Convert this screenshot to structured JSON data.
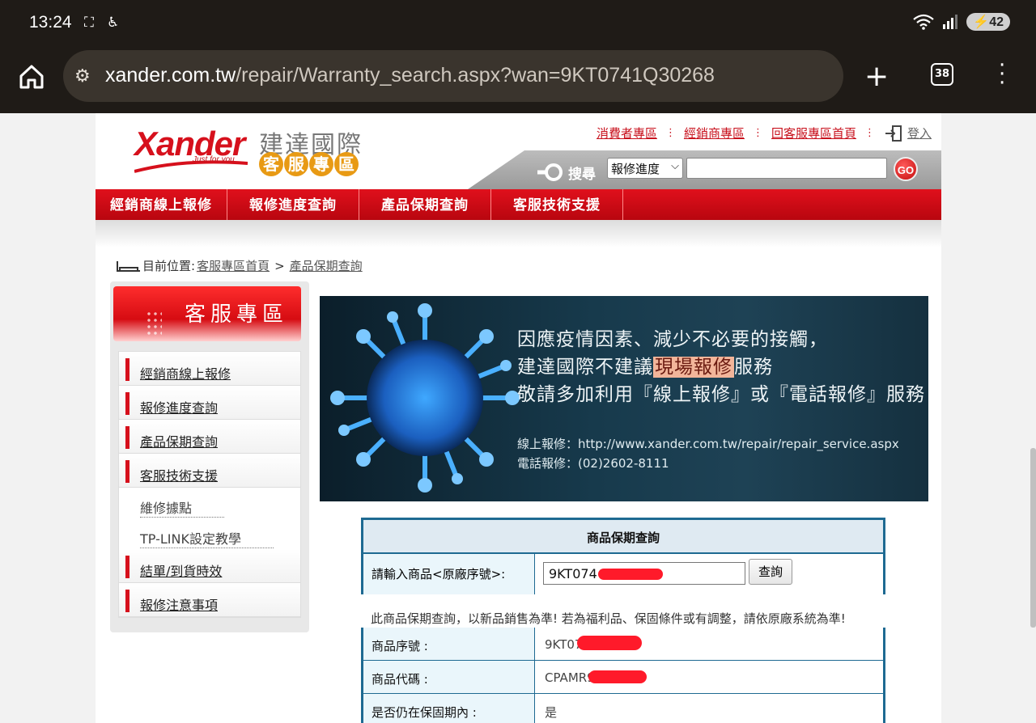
{
  "status": {
    "time": "13:24",
    "battery": "42"
  },
  "browser": {
    "url_host": "xander.com.tw",
    "url_path": "/repair/Warranty_search.aspx?wan=9KT0741Q30268",
    "tab_count": "38"
  },
  "header": {
    "logo_text": "Xander",
    "logo_tagline": "Just for you",
    "logo_cn": "建達國際",
    "logo_cs": [
      "客",
      "服",
      "專",
      "區"
    ],
    "links": [
      "消費者專區",
      "經銷商專區",
      "回客服專區首頁"
    ],
    "login": "登入",
    "search_label": "搜尋",
    "search_select": "報修進度",
    "go": "GO"
  },
  "nav": [
    "經銷商線上報修",
    "報修進度查詢",
    "產品保期查詢",
    "客服技術支援"
  ],
  "breadcrumb": {
    "prefix": "目前位置:",
    "home": "客服專區首頁",
    "sep": ">",
    "current": "產品保期查詢"
  },
  "sidebar": {
    "banner": "客服專區",
    "items": [
      {
        "label": "經銷商線上報修"
      },
      {
        "label": "報修進度查詢"
      },
      {
        "label": "產品保期查詢"
      },
      {
        "label": "客服技術支援"
      }
    ],
    "subitems": [
      {
        "label": "維修據點"
      },
      {
        "label": "TP-LINK設定教學"
      }
    ],
    "items2": [
      {
        "label": "結單/到貨時效"
      },
      {
        "label": "報修注意事項"
      }
    ]
  },
  "covid_banner": {
    "line1": "因應疫情因素、減少不必要的接觸，",
    "line2_a": "建達國際不建議",
    "line2_hl": "現場報修",
    "line2_b": "服務",
    "line3": "敬請多加利用『線上報修』或『電話報修』服務",
    "online": "線上報修：http://www.xander.com.tw/repair/repair_service.aspx",
    "phone": "電話報修：(02)2602-8111"
  },
  "warranty": {
    "title": "商品保期查詢",
    "input_label": "請輸入商品<原廠序號>:",
    "input_value": "9KT074              8",
    "button": "查詢",
    "notice": "此商品保期查詢，以新品銷售為準! 若為福利品、保固條件或有調整，請依原廠系統為準!",
    "results": [
      {
        "key": "商品序號 :",
        "value": "9KT07"
      },
      {
        "key": "商品代碼 :",
        "value": "CPAMR9-"
      },
      {
        "key": "是否仍在保固期內 :",
        "value": "是"
      }
    ]
  },
  "colors": {
    "brand_red": "#d6101c",
    "table_blue": "#1e6a92",
    "accent_orange": "#e89a14"
  }
}
